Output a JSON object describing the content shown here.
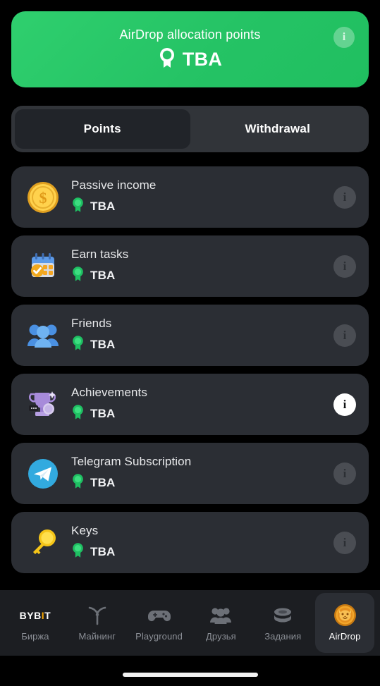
{
  "hero": {
    "title": "AirDrop allocation points",
    "value": "TBA",
    "badge_icon": "medal-badge-icon",
    "info_icon": "info-icon",
    "info_glyph": "i",
    "color": "#26c365"
  },
  "tabs": {
    "items": [
      {
        "label": "Points",
        "active": true
      },
      {
        "label": "Withdrawal",
        "active": false
      }
    ]
  },
  "list": {
    "rows": [
      {
        "title": "Passive income",
        "value": "TBA",
        "icon": "gold-coin-icon",
        "info_active": false,
        "info_glyph": "i"
      },
      {
        "title": "Earn tasks",
        "value": "TBA",
        "icon": "calendar-check-icon",
        "info_active": false,
        "info_glyph": "i"
      },
      {
        "title": "Friends",
        "value": "TBA",
        "icon": "people-group-icon",
        "info_active": false,
        "info_glyph": "i"
      },
      {
        "title": "Achievements",
        "value": "TBA",
        "icon": "trophy-icon",
        "info_active": true,
        "info_glyph": "i"
      },
      {
        "title": "Telegram Subscription",
        "value": "TBA",
        "icon": "telegram-icon",
        "info_active": false,
        "info_glyph": "i"
      },
      {
        "title": "Keys",
        "value": "TBA",
        "icon": "gold-key-icon",
        "info_active": false,
        "info_glyph": "i"
      }
    ],
    "badge_icon": "green-medal-badge-icon"
  },
  "nav": {
    "items": [
      {
        "label": "Биржа",
        "icon": "bybit-logo-icon",
        "logo_parts": [
          "BYB",
          "I",
          "T"
        ],
        "active": false
      },
      {
        "label": "Майнинг",
        "icon": "pickaxe-icon",
        "active": false
      },
      {
        "label": "Playground",
        "icon": "gamepad-icon",
        "active": false
      },
      {
        "label": "Друзья",
        "icon": "friends-icon",
        "active": false
      },
      {
        "label": "Задания",
        "icon": "coins-stack-icon",
        "active": false
      },
      {
        "label": "AirDrop",
        "icon": "tiger-coin-icon",
        "active": true
      }
    ],
    "accent": "#f7a600"
  }
}
